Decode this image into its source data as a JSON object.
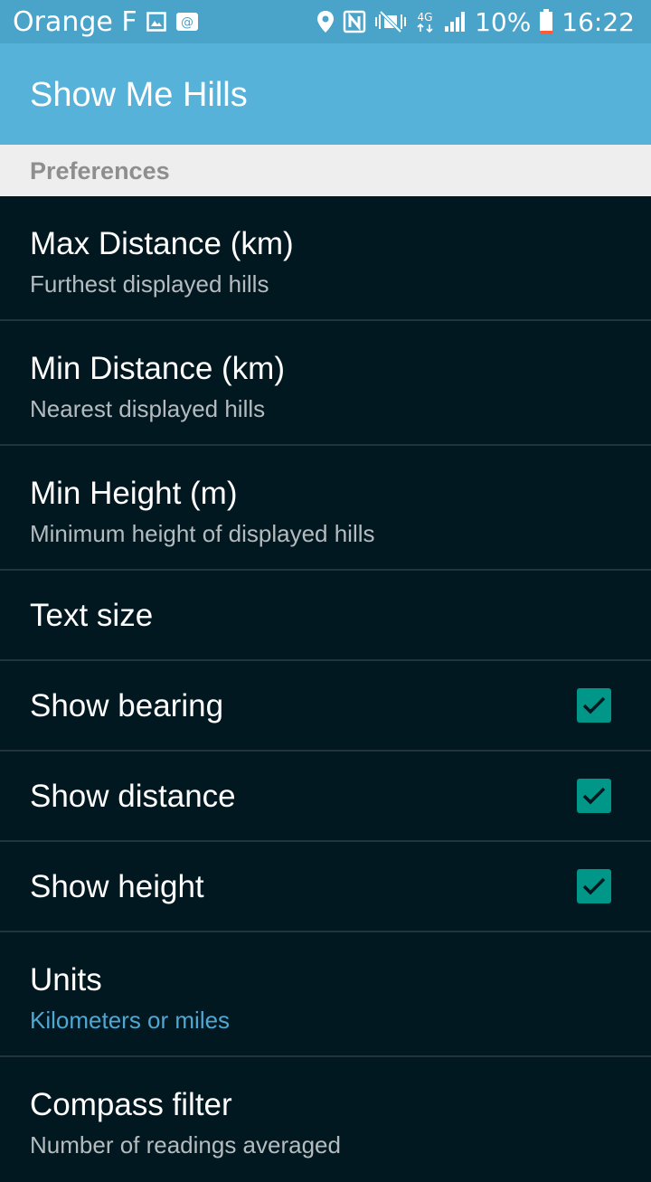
{
  "status_bar": {
    "carrier": "Orange F",
    "network_type": "4G",
    "battery": "10%",
    "time": "16:22",
    "icons": [
      "gallery-icon",
      "email-icon",
      "location-icon",
      "nfc-icon",
      "mute-icon",
      "signal-icon",
      "battery-icon"
    ]
  },
  "app_bar": {
    "title": "Show Me Hills"
  },
  "category": {
    "title": "Preferences"
  },
  "preferences": [
    {
      "title": "Max Distance (km)",
      "summary": "Furthest displayed hills"
    },
    {
      "title": "Min Distance (km)",
      "summary": "Nearest displayed hills"
    },
    {
      "title": "Min Height (m)",
      "summary": "Minimum height of displayed hills"
    },
    {
      "title": "Text size"
    },
    {
      "title": "Show bearing",
      "checked": true
    },
    {
      "title": "Show distance",
      "checked": true
    },
    {
      "title": "Show height",
      "checked": true
    },
    {
      "title": "Units",
      "summary": "Kilometers or miles"
    },
    {
      "title": "Compass filter",
      "summary": "Number of readings averaged"
    }
  ],
  "colors": {
    "status_bar": "#4aa3c9",
    "app_bar": "#57b2da",
    "background": "#021820",
    "checkbox": "#009688",
    "accent_text": "#4fa7d3"
  }
}
